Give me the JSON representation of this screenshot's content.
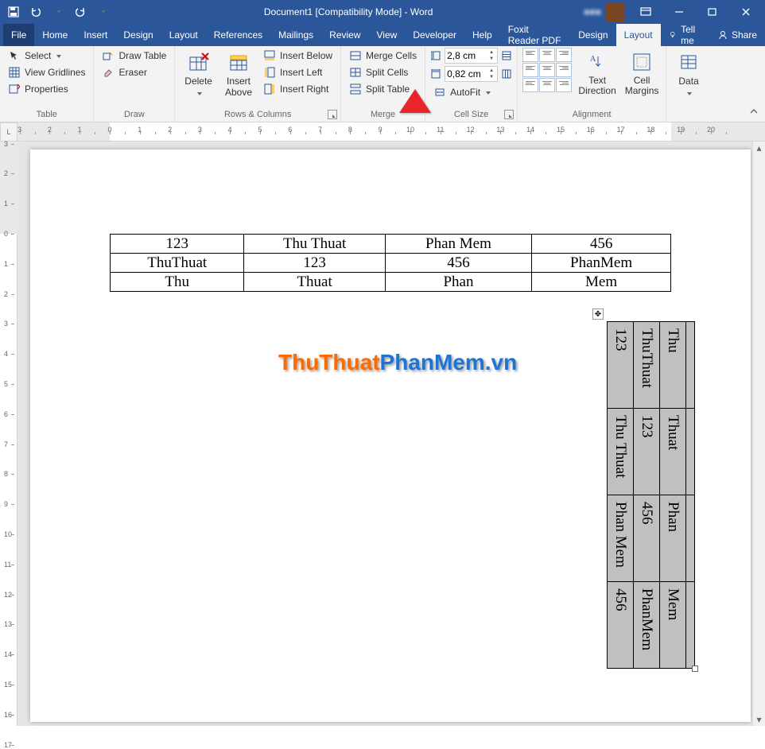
{
  "titlebar": {
    "title": "Document1 [Compatibility Mode] - Word",
    "username_obscured": "■■■"
  },
  "tabs": {
    "file": "File",
    "home": "Home",
    "insert": "Insert",
    "design": "Design",
    "layout": "Layout",
    "references": "References",
    "mailings": "Mailings",
    "review": "Review",
    "view": "View",
    "developer": "Developer",
    "help": "Help",
    "foxit": "Foxit Reader PDF",
    "table_design": "Design",
    "table_layout": "Layout",
    "tell_me": "Tell me",
    "share": "Share"
  },
  "ribbon": {
    "table": {
      "select": "Select",
      "view_gridlines": "View Gridlines",
      "properties": "Properties",
      "group": "Table"
    },
    "draw": {
      "draw_table": "Draw Table",
      "eraser": "Eraser",
      "group": "Draw"
    },
    "rows_columns": {
      "delete": "Delete",
      "insert_above": "Insert\nAbove",
      "insert_below": "Insert Below",
      "insert_left": "Insert Left",
      "insert_right": "Insert Right",
      "group": "Rows & Columns"
    },
    "merge": {
      "merge_cells": "Merge Cells",
      "split_cells": "Split Cells",
      "split_table": "Split Table",
      "group": "Merge"
    },
    "cell_size": {
      "height": "2,8 cm",
      "width": "0,82 cm",
      "autofit": "AutoFit",
      "group": "Cell Size"
    },
    "alignment": {
      "text_direction": "Text\nDirection",
      "cell_margins": "Cell\nMargins",
      "group": "Alignment"
    },
    "data": {
      "data": "Data",
      "group": ""
    }
  },
  "ruler_corner": "L",
  "doc": {
    "table1": [
      [
        "123",
        "Thu Thuat",
        "Phan Mem",
        "456"
      ],
      [
        "ThuThuat",
        "123",
        "456",
        "PhanMem"
      ],
      [
        "Thu",
        "Thuat",
        "Phan",
        "Mem"
      ]
    ],
    "table2_cols": [
      [
        "123",
        "Thu Thuat",
        "Phan Mem",
        "456"
      ],
      [
        "ThuThuat",
        "123",
        "456",
        "PhanMem"
      ],
      [
        "Thu",
        "Thuat",
        "Phan",
        "Mem"
      ]
    ],
    "watermark1": "ThuThuat",
    "watermark2": "PhanMem",
    "watermark3": ".vn"
  }
}
